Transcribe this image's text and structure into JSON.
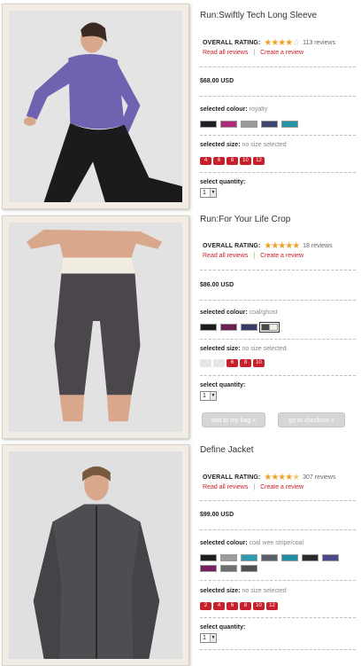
{
  "products": [
    {
      "title": "Run:Swiftly Tech Long Sleeve",
      "rating_label": "OVERALL RATING:",
      "stars_filled": 4,
      "stars_total": 5,
      "reviews_count": "113 reviews",
      "read_reviews": "Read all reviews",
      "create_review": "Create a review",
      "separator": "|",
      "price": "$68.00 USD",
      "colour_label": "selected colour:",
      "colour_value": "royalty",
      "colour_swatches": [
        "#1e1e22",
        "#b02a7a",
        "#9a9a9a",
        "#3d4470",
        "#2394a4"
      ],
      "size_label": "selected size:",
      "size_value": "no size selected",
      "sizes": [
        {
          "label": "4",
          "available": true
        },
        {
          "label": "6",
          "available": true
        },
        {
          "label": "8",
          "available": true
        },
        {
          "label": "10",
          "available": true
        },
        {
          "label": "12",
          "available": true
        }
      ],
      "quantity_label": "select quantity:",
      "quantity_value": "1"
    },
    {
      "title": "Run:For Your Life Crop",
      "rating_label": "OVERALL RATING:",
      "stars_filled": 5,
      "stars_total": 5,
      "reviews_count": "18 reviews",
      "read_reviews": "Read all reviews",
      "create_review": "Create a review",
      "separator": "|",
      "price": "$86.00 USD",
      "colour_label": "selected colour:",
      "colour_value": "coal/ghost",
      "colour_swatches": [
        "#1c1c1c",
        "#6a1f4e",
        "#3a3a6a",
        "#4a4a4a"
      ],
      "size_label": "selected size:",
      "size_value": "no size selected",
      "sizes": [
        {
          "label": "2",
          "available": false
        },
        {
          "label": "4",
          "available": false
        },
        {
          "label": "6",
          "available": true
        },
        {
          "label": "8",
          "available": true
        },
        {
          "label": "10",
          "available": true
        }
      ],
      "quantity_label": "select quantity:",
      "quantity_value": "1",
      "add_to_bag": "add to my bag »",
      "checkout": "go to checkout »"
    },
    {
      "title": "Define Jacket",
      "rating_label": "OVERALL RATING:",
      "stars_filled": 4.5,
      "stars_total": 5,
      "reviews_count": "307 reviews",
      "read_reviews": "Read all reviews",
      "create_review": "Create a review",
      "separator": "|",
      "price": "$99.00 USD",
      "colour_label": "selected colour:",
      "colour_value": "coal wee stripe/coal",
      "colour_swatches": [
        "#1e1e1e",
        "#9c9c9c",
        "#2a9bb0",
        "#5a5f6a",
        "#1f8fa8",
        "#2a2a2a",
        "#4a4a8a",
        "#7a2060",
        "#6f6f6f",
        "#505050"
      ],
      "size_label": "selected size:",
      "size_value": "no size selected",
      "sizes": [
        {
          "label": "2",
          "available": true
        },
        {
          "label": "4",
          "available": true
        },
        {
          "label": "6",
          "available": true
        },
        {
          "label": "8",
          "available": true
        },
        {
          "label": "10",
          "available": true
        },
        {
          "label": "12",
          "available": true
        }
      ],
      "quantity_label": "select quantity:",
      "quantity_value": "1"
    }
  ],
  "colors": {
    "accent_red": "#c8202a",
    "star_orange": "#f0a020",
    "frame_beige": "#f1ede4"
  }
}
